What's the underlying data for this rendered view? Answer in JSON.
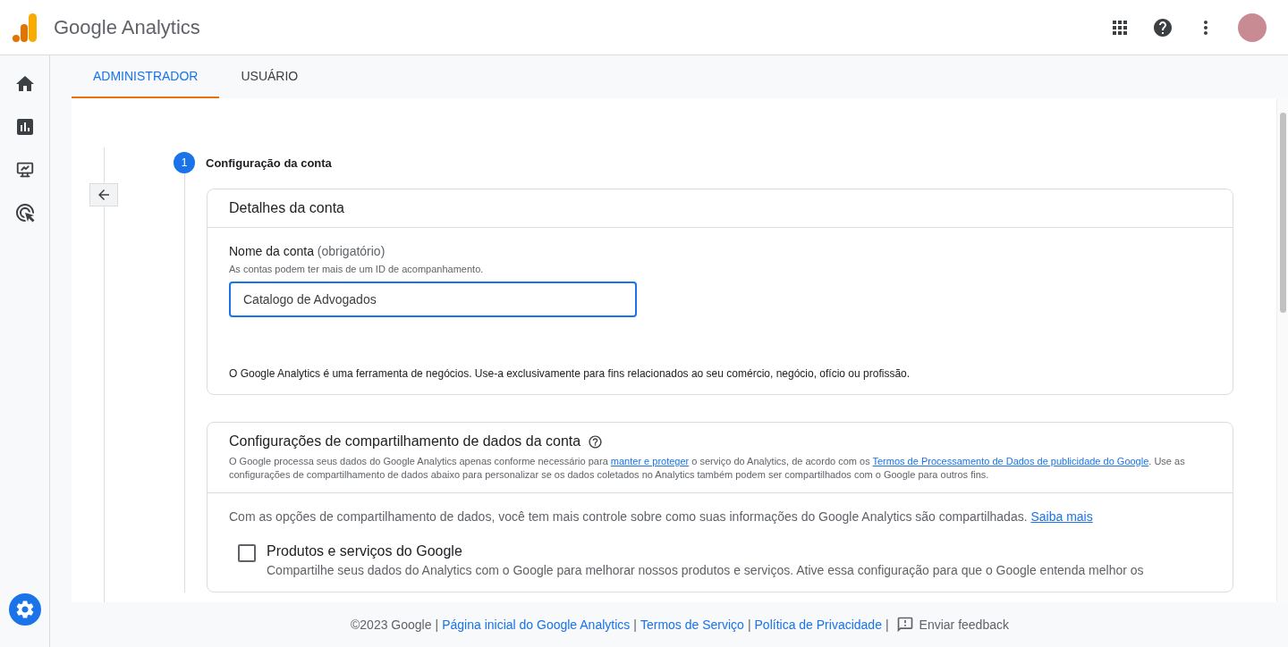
{
  "app": {
    "title": "Google Analytics"
  },
  "tabs": [
    {
      "label": "ADMINISTRADOR",
      "selected": true
    },
    {
      "label": "USUÁRIO",
      "selected": false
    }
  ],
  "step": {
    "number": "1",
    "title": "Configuração da conta"
  },
  "account_card": {
    "title": "Detalhes da conta",
    "field_label": "Nome da conta",
    "field_hint": "(obrigatório)",
    "field_help": "As contas podem ter mais de um ID de acompanhamento.",
    "field_value": "Catalogo de Advogados",
    "notice": "O Google Analytics é uma ferramenta de negócios. Use-a exclusivamente para fins relacionados ao seu comércio, negócio, ofício ou profissão."
  },
  "sharing_card": {
    "title": "Configurações de compartilhamento de dados da conta",
    "description": [
      {
        "kind": "text",
        "text": "O Google processa seus dados do Google Analytics apenas conforme necessário para "
      },
      {
        "kind": "link",
        "text": "manter e proteger"
      },
      {
        "kind": "text",
        "text": " o serviço do Analytics, de acordo com os "
      },
      {
        "kind": "link",
        "text": "Termos de Processamento de Dados de publicidade do Google"
      },
      {
        "kind": "text",
        "text": ". Use as configurações de compartilhamento de dados abaixo para personalizar se os dados coletados no Analytics também podem ser compartilhados com o Google para outros fins."
      }
    ],
    "intro": [
      {
        "kind": "text",
        "text": "Com as opções de compartilhamento de dados, você tem mais controle sobre como suas informações do Google Analytics são compartilhadas. "
      },
      {
        "kind": "link",
        "text": "Saiba mais"
      }
    ],
    "options": [
      {
        "label": "Produtos e serviços do Google",
        "description": "Compartilhe seus dados do Analytics com o Google para melhorar nossos produtos e serviços. Ative essa configuração para que o Google entenda melhor os",
        "checked": false
      }
    ]
  },
  "footer": {
    "copyright": "©2023 Google",
    "separator": "|",
    "links": [
      "Página inicial do Google Analytics",
      "Termos de Serviço",
      "Política de Privacidade"
    ],
    "feedback": "Enviar feedback"
  }
}
